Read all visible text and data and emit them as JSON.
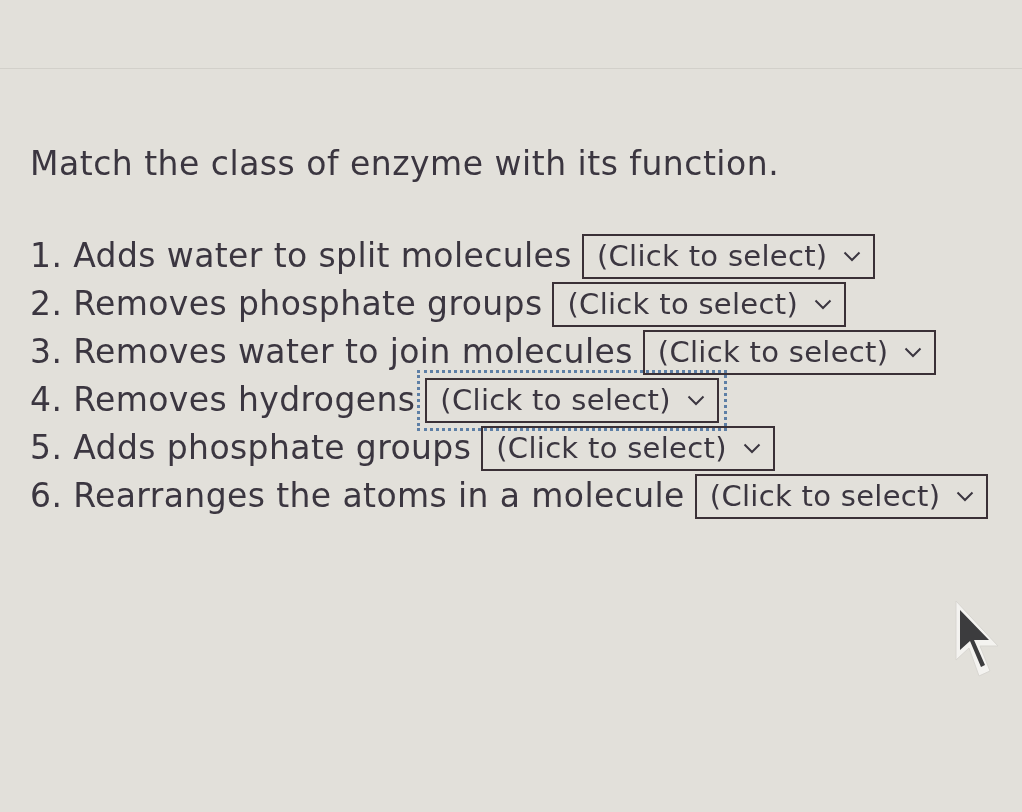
{
  "prompt": "Match the class of enzyme with its function.",
  "items": [
    {
      "label": "1. Adds water to split molecules",
      "select": {
        "value": "(Click to select)",
        "focused": false
      }
    },
    {
      "label": "2. Removes phosphate groups",
      "select": {
        "value": "(Click to select)",
        "focused": false
      }
    },
    {
      "label": "3. Removes water to join molecules",
      "select": {
        "value": "(Click to select)",
        "focused": false
      }
    },
    {
      "label": "4. Removes hydrogens",
      "select": {
        "value": "(Click to select)",
        "focused": true
      }
    },
    {
      "label": "5. Adds phosphate groups",
      "select": {
        "value": "(Click to select)",
        "focused": false
      }
    },
    {
      "label": "6. Rearranges the atoms in a molecule",
      "select": {
        "value": "(Click to select)",
        "focused": false
      }
    }
  ]
}
